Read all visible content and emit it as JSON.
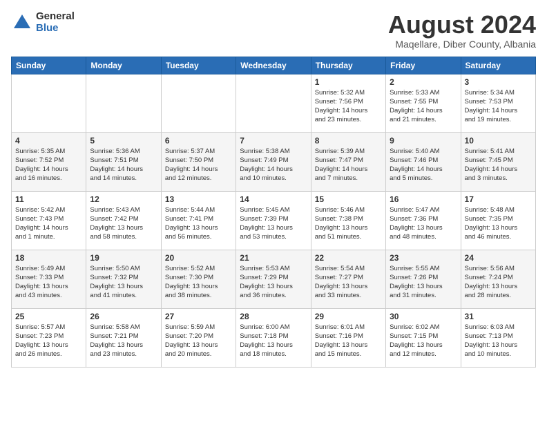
{
  "header": {
    "logo_general": "General",
    "logo_blue": "Blue",
    "main_title": "August 2024",
    "subtitle": "Maqellare, Diber County, Albania"
  },
  "weekdays": [
    "Sunday",
    "Monday",
    "Tuesday",
    "Wednesday",
    "Thursday",
    "Friday",
    "Saturday"
  ],
  "weeks": [
    [
      {
        "day": "",
        "info": ""
      },
      {
        "day": "",
        "info": ""
      },
      {
        "day": "",
        "info": ""
      },
      {
        "day": "",
        "info": ""
      },
      {
        "day": "1",
        "info": "Sunrise: 5:32 AM\nSunset: 7:56 PM\nDaylight: 14 hours\nand 23 minutes."
      },
      {
        "day": "2",
        "info": "Sunrise: 5:33 AM\nSunset: 7:55 PM\nDaylight: 14 hours\nand 21 minutes."
      },
      {
        "day": "3",
        "info": "Sunrise: 5:34 AM\nSunset: 7:53 PM\nDaylight: 14 hours\nand 19 minutes."
      }
    ],
    [
      {
        "day": "4",
        "info": "Sunrise: 5:35 AM\nSunset: 7:52 PM\nDaylight: 14 hours\nand 16 minutes."
      },
      {
        "day": "5",
        "info": "Sunrise: 5:36 AM\nSunset: 7:51 PM\nDaylight: 14 hours\nand 14 minutes."
      },
      {
        "day": "6",
        "info": "Sunrise: 5:37 AM\nSunset: 7:50 PM\nDaylight: 14 hours\nand 12 minutes."
      },
      {
        "day": "7",
        "info": "Sunrise: 5:38 AM\nSunset: 7:49 PM\nDaylight: 14 hours\nand 10 minutes."
      },
      {
        "day": "8",
        "info": "Sunrise: 5:39 AM\nSunset: 7:47 PM\nDaylight: 14 hours\nand 7 minutes."
      },
      {
        "day": "9",
        "info": "Sunrise: 5:40 AM\nSunset: 7:46 PM\nDaylight: 14 hours\nand 5 minutes."
      },
      {
        "day": "10",
        "info": "Sunrise: 5:41 AM\nSunset: 7:45 PM\nDaylight: 14 hours\nand 3 minutes."
      }
    ],
    [
      {
        "day": "11",
        "info": "Sunrise: 5:42 AM\nSunset: 7:43 PM\nDaylight: 14 hours\nand 1 minute."
      },
      {
        "day": "12",
        "info": "Sunrise: 5:43 AM\nSunset: 7:42 PM\nDaylight: 13 hours\nand 58 minutes."
      },
      {
        "day": "13",
        "info": "Sunrise: 5:44 AM\nSunset: 7:41 PM\nDaylight: 13 hours\nand 56 minutes."
      },
      {
        "day": "14",
        "info": "Sunrise: 5:45 AM\nSunset: 7:39 PM\nDaylight: 13 hours\nand 53 minutes."
      },
      {
        "day": "15",
        "info": "Sunrise: 5:46 AM\nSunset: 7:38 PM\nDaylight: 13 hours\nand 51 minutes."
      },
      {
        "day": "16",
        "info": "Sunrise: 5:47 AM\nSunset: 7:36 PM\nDaylight: 13 hours\nand 48 minutes."
      },
      {
        "day": "17",
        "info": "Sunrise: 5:48 AM\nSunset: 7:35 PM\nDaylight: 13 hours\nand 46 minutes."
      }
    ],
    [
      {
        "day": "18",
        "info": "Sunrise: 5:49 AM\nSunset: 7:33 PM\nDaylight: 13 hours\nand 43 minutes."
      },
      {
        "day": "19",
        "info": "Sunrise: 5:50 AM\nSunset: 7:32 PM\nDaylight: 13 hours\nand 41 minutes."
      },
      {
        "day": "20",
        "info": "Sunrise: 5:52 AM\nSunset: 7:30 PM\nDaylight: 13 hours\nand 38 minutes."
      },
      {
        "day": "21",
        "info": "Sunrise: 5:53 AM\nSunset: 7:29 PM\nDaylight: 13 hours\nand 36 minutes."
      },
      {
        "day": "22",
        "info": "Sunrise: 5:54 AM\nSunset: 7:27 PM\nDaylight: 13 hours\nand 33 minutes."
      },
      {
        "day": "23",
        "info": "Sunrise: 5:55 AM\nSunset: 7:26 PM\nDaylight: 13 hours\nand 31 minutes."
      },
      {
        "day": "24",
        "info": "Sunrise: 5:56 AM\nSunset: 7:24 PM\nDaylight: 13 hours\nand 28 minutes."
      }
    ],
    [
      {
        "day": "25",
        "info": "Sunrise: 5:57 AM\nSunset: 7:23 PM\nDaylight: 13 hours\nand 26 minutes."
      },
      {
        "day": "26",
        "info": "Sunrise: 5:58 AM\nSunset: 7:21 PM\nDaylight: 13 hours\nand 23 minutes."
      },
      {
        "day": "27",
        "info": "Sunrise: 5:59 AM\nSunset: 7:20 PM\nDaylight: 13 hours\nand 20 minutes."
      },
      {
        "day": "28",
        "info": "Sunrise: 6:00 AM\nSunset: 7:18 PM\nDaylight: 13 hours\nand 18 minutes."
      },
      {
        "day": "29",
        "info": "Sunrise: 6:01 AM\nSunset: 7:16 PM\nDaylight: 13 hours\nand 15 minutes."
      },
      {
        "day": "30",
        "info": "Sunrise: 6:02 AM\nSunset: 7:15 PM\nDaylight: 13 hours\nand 12 minutes."
      },
      {
        "day": "31",
        "info": "Sunrise: 6:03 AM\nSunset: 7:13 PM\nDaylight: 13 hours\nand 10 minutes."
      }
    ]
  ]
}
